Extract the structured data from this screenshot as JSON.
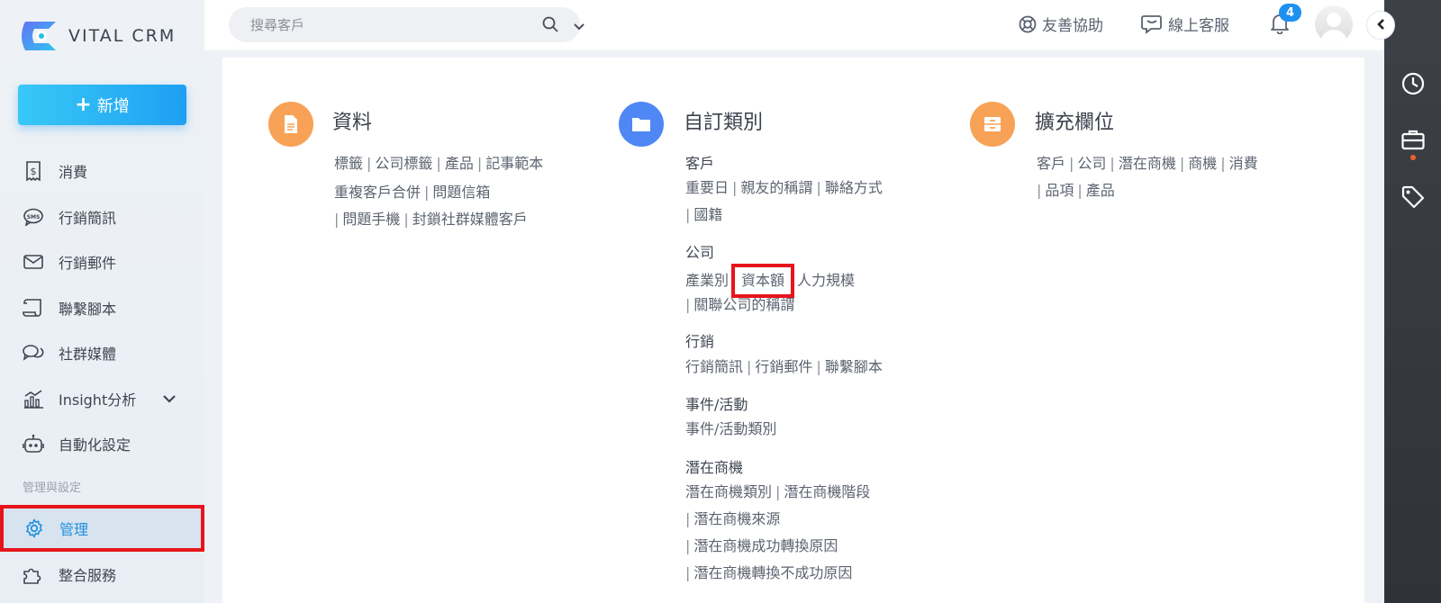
{
  "brand": {
    "name": "VITAL CRM"
  },
  "sidebar": {
    "add_label": "新增",
    "items": [
      {
        "label": "消費",
        "icon": "receipt-dollar-icon"
      },
      {
        "label": "行銷簡訊",
        "icon": "sms-bubble-icon"
      },
      {
        "label": "行銷郵件",
        "icon": "envelope-icon"
      },
      {
        "label": "聯繫腳本",
        "icon": "script-scroll-icon"
      },
      {
        "label": "社群媒體",
        "icon": "chat-bubbles-icon"
      },
      {
        "label": "Insight分析",
        "icon": "analytics-chart-icon"
      },
      {
        "label": "自動化設定",
        "icon": "robot-icon"
      }
    ],
    "section_label": "管理與設定",
    "active_item": {
      "label": "管理",
      "icon": "gear-icon"
    },
    "last_item": {
      "label": "整合服務",
      "icon": "puzzle-icon"
    }
  },
  "topbar": {
    "search_placeholder": "搜尋客戶",
    "help_label": "友善協助",
    "support_label": "線上客服",
    "notification_count": "4"
  },
  "columns": {
    "data": {
      "title": "資料",
      "lines": [
        [
          "標籤",
          "公司標籤",
          "產品",
          "記事範本"
        ],
        [
          "重複客戶合併",
          "問題信箱"
        ],
        [
          "",
          "問題手機",
          "封鎖社群媒體客戶"
        ]
      ]
    },
    "custom": {
      "title": "自訂類別",
      "customer": {
        "title": "客戶",
        "line1": [
          "重要日",
          "親友的稱謂",
          "聯絡方式"
        ],
        "line2": [
          "",
          "國籍"
        ]
      },
      "company": {
        "title": "公司",
        "item1": "產業別",
        "item2": "資本額",
        "item3": "人力規模",
        "line2": [
          "",
          "關聯公司的稱謂"
        ]
      },
      "marketing": {
        "title": "行銷",
        "line1": [
          "行銷簡訊",
          "行銷郵件",
          "聯繫腳本"
        ]
      },
      "events": {
        "title": "事件/活動",
        "line1": [
          "事件/活動類別"
        ]
      },
      "leads": {
        "title": "潛在商機",
        "line1": [
          "潛在商機類別",
          "潛在商機階段"
        ],
        "line2": [
          "",
          "潛在商機來源"
        ],
        "line3": [
          "",
          "潛在商機成功轉換原因"
        ],
        "line4": [
          "",
          "潛在商機轉換不成功原因"
        ]
      }
    },
    "extended": {
      "title": "擴充欄位",
      "line1": [
        "客戶",
        "公司",
        "潛在商機",
        "商機",
        "消費"
      ],
      "line2": [
        "",
        "品項",
        "產品"
      ]
    }
  },
  "colors": {
    "accent": "#1e90f0",
    "highlight": "#e8141b",
    "orange": "#f8a257",
    "blue_icon": "#4f87f4",
    "rail": "#35393e"
  }
}
